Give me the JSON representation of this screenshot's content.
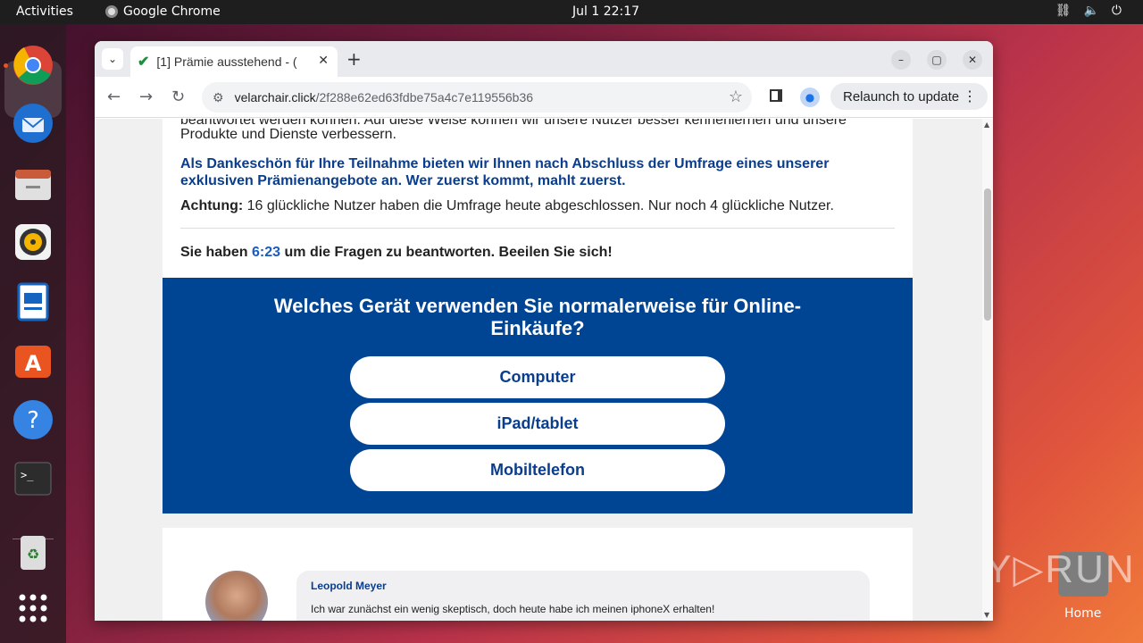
{
  "topbar": {
    "activities": "Activities",
    "app_name": "Google Chrome",
    "clock": "Jul 1  22:17"
  },
  "dock": {
    "items": [
      "chrome-icon",
      "thunderbird-icon",
      "files-icon",
      "rhythmbox-icon",
      "writer-icon",
      "app-center-icon",
      "help-icon",
      "terminal-icon",
      "trash-icon",
      "app-grid-icon"
    ]
  },
  "desktop": {
    "home_label": "Home",
    "watermark": "ANY▷RUN"
  },
  "browser": {
    "tab_title": "[1] Prämie ausstehend - (",
    "url_host": "velarchair.click",
    "url_path": "/2f288e62ed63fdbe75a4c7e119556b36",
    "relaunch_label": "Relaunch to update"
  },
  "page": {
    "cut_text": "beantwortet werden können. Auf diese Weise können wir unsere Nutzer besser kennenlernen und unsere",
    "intro_cont": "Produkte und Dienste verbessern.",
    "thanks": "Als Dankeschön für Ihre Teilnahme bieten wir Ihnen nach Abschluss der Umfrage eines unserer exklusiven Prämienangebote an. Wer zuerst kommt, mahlt zuerst.",
    "attention_label": "Achtung:",
    "attention_text": " 16 glückliche Nutzer haben die Umfrage heute abgeschlossen. Nur noch 4 glückliche Nutzer.",
    "timer_pre": "Sie haben ",
    "timer_value": "6:23",
    "timer_post": " um die Fragen zu beantworten. Beeilen Sie sich!",
    "question": "Welches Gerät verwenden Sie normalerweise für Online-Einkäufe?",
    "answers": [
      "Computer",
      "iPad/tablet",
      "Mobiltelefon"
    ],
    "comment": {
      "name": "Leopold Meyer",
      "text": "Ich war zunächst ein wenig skeptisch, doch heute habe ich meinen iphoneX erhalten!"
    }
  }
}
